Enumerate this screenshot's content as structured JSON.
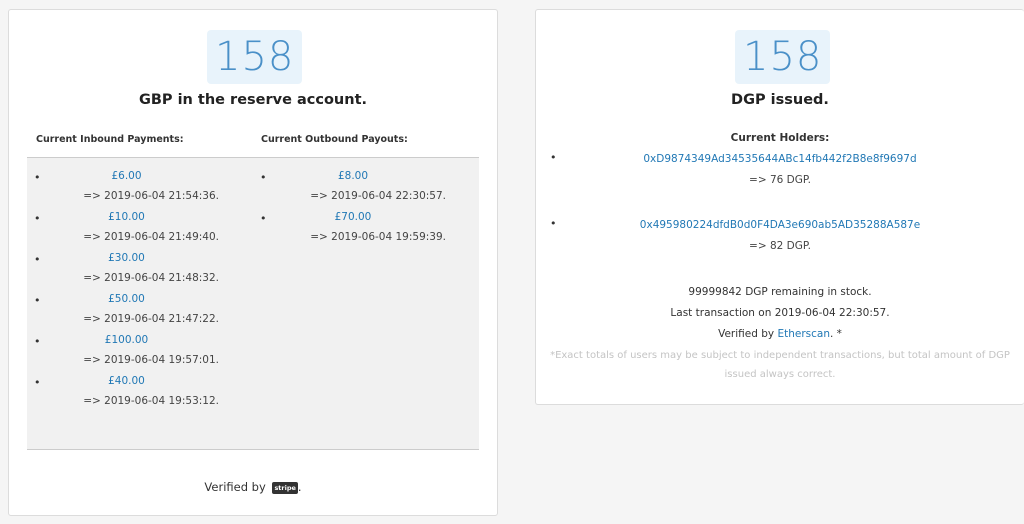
{
  "reserve": {
    "count": "158",
    "subtitle": "GBP in the reserve account.",
    "inbound_header": "Current Inbound Payments:",
    "outbound_header": "Current Outbound Payouts:",
    "inbound": [
      {
        "amount": "£6.00",
        "time": "=> 2019-06-04 21:54:36."
      },
      {
        "amount": "£10.00",
        "time": "=> 2019-06-04 21:49:40."
      },
      {
        "amount": "£30.00",
        "time": "=> 2019-06-04 21:48:32."
      },
      {
        "amount": "£50.00",
        "time": "=> 2019-06-04 21:47:22."
      },
      {
        "amount": "£100.00",
        "time": "=> 2019-06-04 19:57:01."
      },
      {
        "amount": "£40.00",
        "time": "=> 2019-06-04 19:53:12."
      }
    ],
    "outbound": [
      {
        "amount": "£8.00",
        "time": "=> 2019-06-04 22:30:57."
      },
      {
        "amount": "£70.00",
        "time": "=> 2019-06-04 19:59:39."
      }
    ],
    "verified_prefix": "Verified by",
    "stripe_logo_text": "stripe",
    "verified_suffix": "."
  },
  "issued": {
    "count": "158",
    "subtitle": "DGP issued.",
    "holders_header": "Current Holders:",
    "holders": [
      {
        "address": "0xD9874349Ad34535644ABc14fb442f2B8e8f9697d",
        "qty": "=> 76 DGP."
      },
      {
        "address": "0x495980224dfdB0d0F4DA3e690ab5AD35288A587e",
        "qty": "=> 82 DGP."
      }
    ],
    "remaining": "99999842 DGP remaining in stock.",
    "last_tx": "Last transaction on 2019-06-04 22:30:57.",
    "verified_prefix": "Verified by ",
    "etherscan_link": "Etherscan",
    "verified_suffix": ". *",
    "note": "*Exact totals of users may be subject to independent transactions, but total amount of DGP issued always correct."
  },
  "colors": {
    "link": "#2178b5",
    "number": "#4a90c8",
    "number_bg": "#e8f3fb"
  }
}
